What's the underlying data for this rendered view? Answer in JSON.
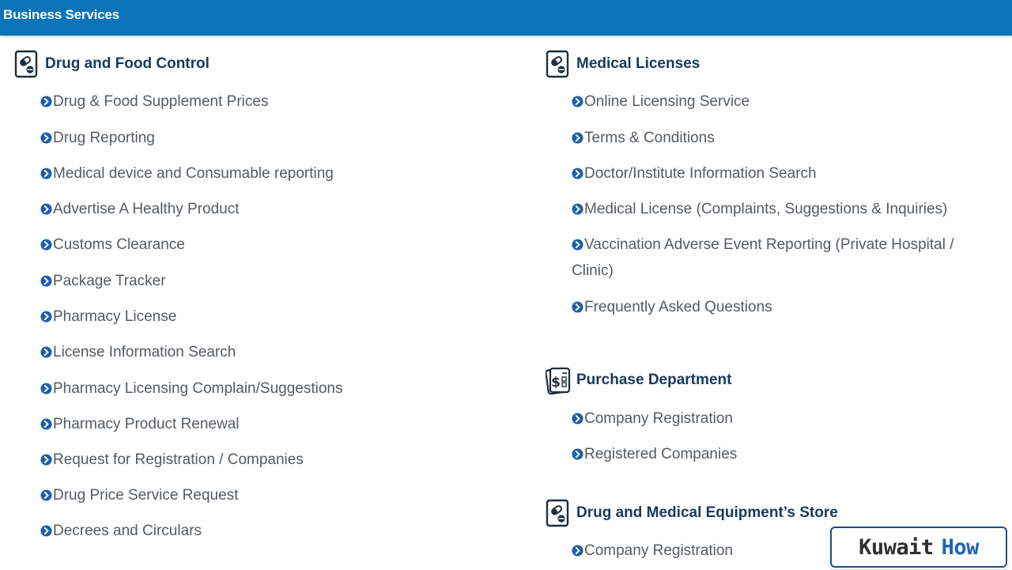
{
  "header": {
    "title": "Business Services",
    "color": "#0d73b8"
  },
  "colors": {
    "section_title": "#173a5e",
    "link_text": "#555b61",
    "arrow_icon": "#1d5fa8"
  },
  "left_column": {
    "section": {
      "title": "Drug and Food Control",
      "icon": "pills-document-icon"
    },
    "links": [
      "Drug & Food Supplement Prices",
      "Drug Reporting",
      "Medical device and Consumable reporting",
      "Advertise A Healthy Product",
      "Customs Clearance",
      "Package Tracker",
      "Pharmacy License",
      "License Information Search",
      "Pharmacy Licensing Complain/Suggestions",
      "Pharmacy Product Renewal",
      "Request for Registration / Companies",
      "Drug Price Service Request",
      "Decrees and Circulars"
    ]
  },
  "right_column": {
    "sections": [
      {
        "title": "Medical Licenses",
        "icon": "pills-document-icon",
        "links": [
          "Online Licensing Service",
          "Terms & Conditions",
          "Doctor/Institute Information Search",
          "Medical License (Complaints, Suggestions & Inquiries)",
          "Vaccination Adverse Event Reporting (Private Hospital / Clinic)",
          "Frequently Asked Questions"
        ]
      },
      {
        "title": "Purchase Department",
        "icon": "dollar-document-icon",
        "links": [
          "Company Registration",
          "Registered Companies"
        ]
      },
      {
        "title": "Drug and Medical Equipment’s Store",
        "icon": "pills-document-icon",
        "links": [
          "Company Registration"
        ]
      }
    ]
  },
  "watermark": {
    "word1": "Kuwait",
    "word2": "How"
  }
}
